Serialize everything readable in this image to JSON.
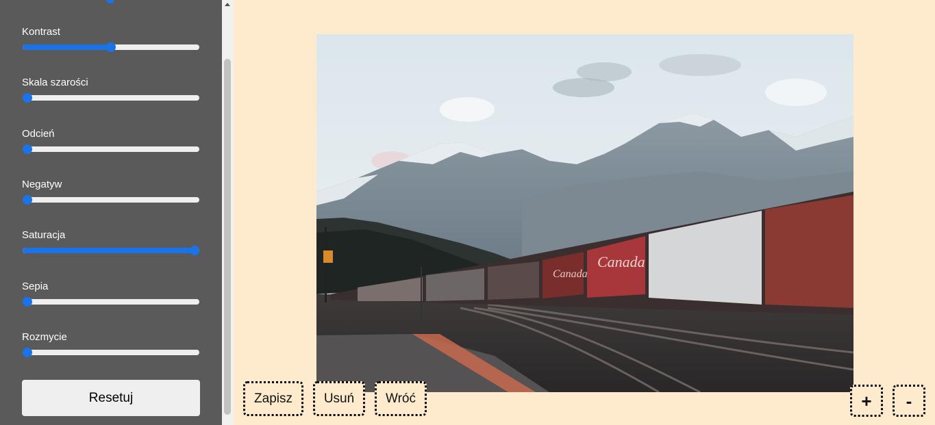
{
  "sidebar": {
    "controls": [
      {
        "label": "Kontrast",
        "value": 0.5
      },
      {
        "label": "Skala szarości",
        "value": 0
      },
      {
        "label": "Odcień",
        "value": 0
      },
      {
        "label": "Negatyw",
        "value": 0
      },
      {
        "label": "Saturacja",
        "value": 1
      },
      {
        "label": "Sepia",
        "value": 0
      },
      {
        "label": "Rozmycie",
        "value": 0
      }
    ],
    "reset_label": "Resetuj"
  },
  "toolbar": {
    "save_label": "Zapisz",
    "delete_label": "Usuń",
    "back_label": "Wróć",
    "zoom_in_label": "+",
    "zoom_out_label": "-"
  },
  "photo": {
    "subject": "mountain-railway-freight-train",
    "car_lettering": "Canada"
  },
  "colors": {
    "sidebar_bg": "#5a5a5a",
    "accent": "#1a73e8",
    "main_bg": "#feebcd"
  }
}
